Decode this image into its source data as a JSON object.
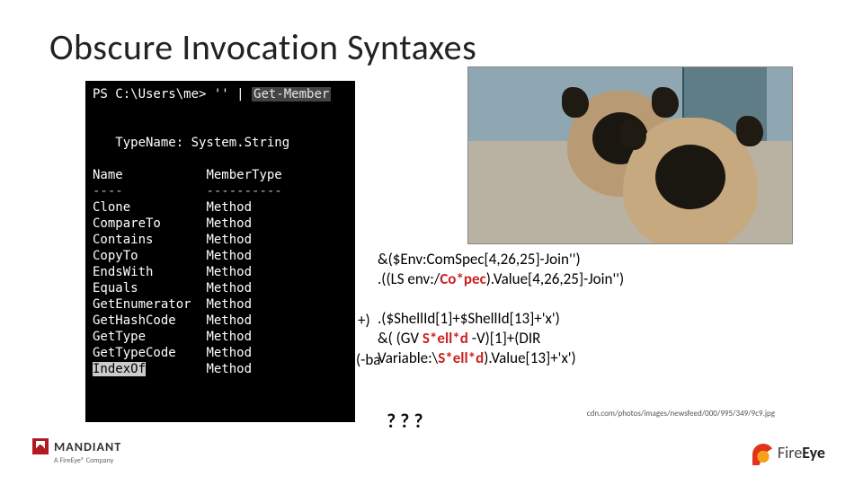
{
  "title": "Obscure Invocation Syntaxes",
  "console": {
    "prompt": "PS C:\\Users\\me> ",
    "input_left": "''",
    "pipe": " | ",
    "cmd": "Get-Member",
    "typeline": "   TypeName: System.String",
    "header_name": "Name",
    "header_type": "MemberType",
    "header_div_name": "----",
    "header_div_type": "----------",
    "rows": [
      [
        "Clone",
        "Method"
      ],
      [
        "CompareTo",
        "Method"
      ],
      [
        "Contains",
        "Method"
      ],
      [
        "CopyTo",
        "Method"
      ],
      [
        "EndsWith",
        "Method"
      ],
      [
        "Equals",
        "Method"
      ],
      [
        "GetEnumerator",
        "Method"
      ],
      [
        "GetHashCode",
        "Method"
      ],
      [
        "GetType",
        "Method"
      ],
      [
        "GetTypeCode",
        "Method"
      ],
      [
        "IndexOf",
        "Method"
      ]
    ]
  },
  "body": {
    "line1_a": "&($Env:ComSpec[4,26,25]-Join'')",
    "line2_a": ".((LS env:/",
    "line2_red": "Co*pec",
    "line2_b": ").Value[4,26,25]-Join'')",
    "peek1": "+)",
    "line3_a": ".($ShellId[1]+$ShellId[13]+'x')",
    "line4_a": "&( (GV ",
    "line4_red": "S*ell*d",
    "line4_b": " -V)[1]+(DIR",
    "peek2": "(-ba",
    "line5_a": "Variable:\\",
    "line5_red": "S*ell*d",
    "line5_b": ").Value[13]+'x')"
  },
  "qmarks": "? ? ?",
  "credit": "cdn.com/photos/images/newsfeed/000/995/349/9c9.jpg",
  "mandiant": {
    "name": "MANDIANT",
    "sub": "A FireEye® Company"
  },
  "fireeye": {
    "pre": "Fire",
    "post": "Eye"
  }
}
